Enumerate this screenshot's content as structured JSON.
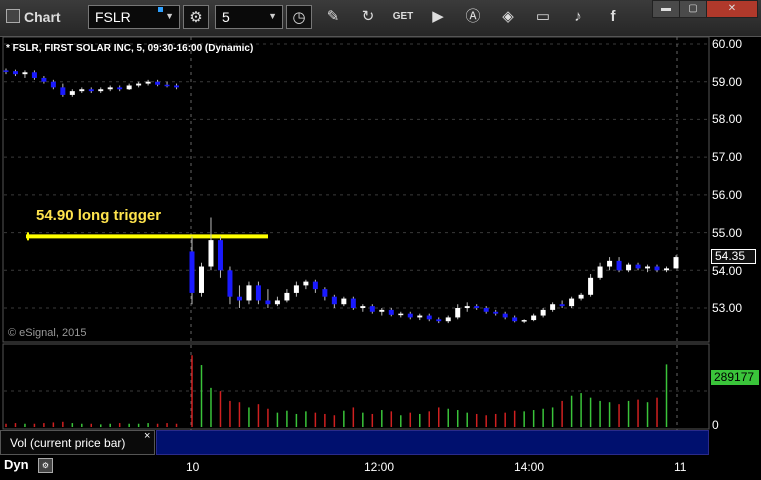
{
  "toolbar": {
    "window_title": "Chart",
    "symbol_value": "FSLR",
    "interval_value": "5",
    "icons": [
      "settings-icon",
      "clock-icon",
      "pencil-icon",
      "refresh-icon",
      "get-icon",
      "play-icon",
      "alert-icon",
      "tag-icon",
      "comment-icon",
      "twitter-icon",
      "facebook-icon"
    ]
  },
  "chart": {
    "legend": "* FSLR, FIRST SOLAR INC, 5, 09:30-16:00 (Dynamic)",
    "copyright": "© eSignal, 2015",
    "annotation": "54.90 long trigger",
    "current_price": "54.35",
    "volume_value": "289177",
    "volume_legend": "Vol (current price bar)",
    "close_mark": "×",
    "bottom_label": "Dyn",
    "y_labels": [
      "60.00",
      "59.00",
      "58.00",
      "57.00",
      "56.00",
      "55.00",
      "54.00",
      "53.00"
    ],
    "vol_y_labels": [
      "0"
    ],
    "x_labels": [
      "10",
      "12:00",
      "14:00",
      "11"
    ],
    "colors": {
      "up": "#ffffff",
      "down": "#1a1aff",
      "trigger": "#ffff00",
      "vol_up": "#3ac43a",
      "vol_down": "#d02020",
      "grid": "#3a3a3a"
    }
  },
  "chart_data": {
    "type": "candlestick",
    "trigger_level": 54.9,
    "ylim": [
      52.5,
      60.2
    ],
    "candles": [
      {
        "o": 59.3,
        "h": 59.35,
        "l": 59.2,
        "c": 59.28
      },
      {
        "o": 59.28,
        "h": 59.32,
        "l": 59.15,
        "c": 59.2
      },
      {
        "o": 59.2,
        "h": 59.3,
        "l": 59.1,
        "c": 59.25
      },
      {
        "o": 59.25,
        "h": 59.3,
        "l": 59.05,
        "c": 59.1
      },
      {
        "o": 59.1,
        "h": 59.15,
        "l": 58.95,
        "c": 59.0
      },
      {
        "o": 59.0,
        "h": 59.05,
        "l": 58.8,
        "c": 58.85
      },
      {
        "o": 58.85,
        "h": 58.95,
        "l": 58.6,
        "c": 58.65
      },
      {
        "o": 58.65,
        "h": 58.8,
        "l": 58.6,
        "c": 58.75
      },
      {
        "o": 58.75,
        "h": 58.85,
        "l": 58.7,
        "c": 58.8
      },
      {
        "o": 58.8,
        "h": 58.85,
        "l": 58.7,
        "c": 58.75
      },
      {
        "o": 58.75,
        "h": 58.85,
        "l": 58.7,
        "c": 58.8
      },
      {
        "o": 58.8,
        "h": 58.9,
        "l": 58.75,
        "c": 58.85
      },
      {
        "o": 58.85,
        "h": 58.9,
        "l": 58.75,
        "c": 58.8
      },
      {
        "o": 58.8,
        "h": 58.95,
        "l": 58.78,
        "c": 58.9
      },
      {
        "o": 58.9,
        "h": 59.0,
        "l": 58.85,
        "c": 58.95
      },
      {
        "o": 58.95,
        "h": 59.05,
        "l": 58.9,
        "c": 59.0
      },
      {
        "o": 59.0,
        "h": 59.05,
        "l": 58.88,
        "c": 58.92
      },
      {
        "o": 58.92,
        "h": 59.0,
        "l": 58.85,
        "c": 58.9
      },
      {
        "o": 58.9,
        "h": 58.95,
        "l": 58.8,
        "c": 58.85
      },
      {
        "o": 54.5,
        "h": 54.9,
        "l": 53.1,
        "c": 53.4
      },
      {
        "o": 53.4,
        "h": 54.2,
        "l": 53.3,
        "c": 54.1
      },
      {
        "o": 54.1,
        "h": 55.4,
        "l": 54.0,
        "c": 54.8
      },
      {
        "o": 54.8,
        "h": 54.9,
        "l": 53.8,
        "c": 54.0
      },
      {
        "o": 54.0,
        "h": 54.1,
        "l": 53.1,
        "c": 53.3
      },
      {
        "o": 53.3,
        "h": 53.6,
        "l": 53.0,
        "c": 53.2
      },
      {
        "o": 53.2,
        "h": 53.7,
        "l": 53.1,
        "c": 53.6
      },
      {
        "o": 53.6,
        "h": 53.7,
        "l": 53.1,
        "c": 53.2
      },
      {
        "o": 53.2,
        "h": 53.5,
        "l": 53.0,
        "c": 53.1
      },
      {
        "o": 53.1,
        "h": 53.3,
        "l": 53.05,
        "c": 53.2
      },
      {
        "o": 53.2,
        "h": 53.5,
        "l": 53.15,
        "c": 53.4
      },
      {
        "o": 53.4,
        "h": 53.7,
        "l": 53.3,
        "c": 53.6
      },
      {
        "o": 53.6,
        "h": 53.75,
        "l": 53.5,
        "c": 53.7
      },
      {
        "o": 53.7,
        "h": 53.75,
        "l": 53.4,
        "c": 53.5
      },
      {
        "o": 53.5,
        "h": 53.55,
        "l": 53.2,
        "c": 53.3
      },
      {
        "o": 53.3,
        "h": 53.35,
        "l": 53.0,
        "c": 53.1
      },
      {
        "o": 53.1,
        "h": 53.3,
        "l": 53.05,
        "c": 53.25
      },
      {
        "o": 53.25,
        "h": 53.3,
        "l": 52.95,
        "c": 53.0
      },
      {
        "o": 53.0,
        "h": 53.1,
        "l": 52.9,
        "c": 53.05
      },
      {
        "o": 53.05,
        "h": 53.1,
        "l": 52.85,
        "c": 52.9
      },
      {
        "o": 52.9,
        "h": 53.0,
        "l": 52.8,
        "c": 52.95
      },
      {
        "o": 52.95,
        "h": 53.0,
        "l": 52.78,
        "c": 52.82
      },
      {
        "o": 52.82,
        "h": 52.9,
        "l": 52.75,
        "c": 52.85
      },
      {
        "o": 52.85,
        "h": 52.9,
        "l": 52.7,
        "c": 52.75
      },
      {
        "o": 52.75,
        "h": 52.85,
        "l": 52.68,
        "c": 52.8
      },
      {
        "o": 52.8,
        "h": 52.85,
        "l": 52.65,
        "c": 52.7
      },
      {
        "o": 52.7,
        "h": 52.75,
        "l": 52.6,
        "c": 52.65
      },
      {
        "o": 52.65,
        "h": 52.8,
        "l": 52.6,
        "c": 52.75
      },
      {
        "o": 52.75,
        "h": 53.1,
        "l": 52.7,
        "c": 53.0
      },
      {
        "o": 53.0,
        "h": 53.15,
        "l": 52.9,
        "c": 53.05
      },
      {
        "o": 53.05,
        "h": 53.1,
        "l": 52.95,
        "c": 53.0
      },
      {
        "o": 53.0,
        "h": 53.05,
        "l": 52.85,
        "c": 52.9
      },
      {
        "o": 52.9,
        "h": 52.95,
        "l": 52.8,
        "c": 52.85
      },
      {
        "o": 52.85,
        "h": 52.9,
        "l": 52.7,
        "c": 52.75
      },
      {
        "o": 52.75,
        "h": 52.8,
        "l": 52.62,
        "c": 52.65
      },
      {
        "o": 52.65,
        "h": 52.7,
        "l": 52.6,
        "c": 52.68
      },
      {
        "o": 52.68,
        "h": 52.85,
        "l": 52.65,
        "c": 52.8
      },
      {
        "o": 52.8,
        "h": 53.0,
        "l": 52.75,
        "c": 52.95
      },
      {
        "o": 52.95,
        "h": 53.15,
        "l": 52.9,
        "c": 53.1
      },
      {
        "o": 53.1,
        "h": 53.2,
        "l": 53.0,
        "c": 53.05
      },
      {
        "o": 53.05,
        "h": 53.3,
        "l": 53.0,
        "c": 53.25
      },
      {
        "o": 53.25,
        "h": 53.4,
        "l": 53.2,
        "c": 53.35
      },
      {
        "o": 53.35,
        "h": 53.9,
        "l": 53.3,
        "c": 53.8
      },
      {
        "o": 53.8,
        "h": 54.2,
        "l": 53.75,
        "c": 54.1
      },
      {
        "o": 54.1,
        "h": 54.35,
        "l": 54.0,
        "c": 54.25
      },
      {
        "o": 54.25,
        "h": 54.35,
        "l": 53.95,
        "c": 54.0
      },
      {
        "o": 54.0,
        "h": 54.2,
        "l": 53.95,
        "c": 54.15
      },
      {
        "o": 54.15,
        "h": 54.2,
        "l": 54.0,
        "c": 54.05
      },
      {
        "o": 54.05,
        "h": 54.15,
        "l": 53.95,
        "c": 54.1
      },
      {
        "o": 54.1,
        "h": 54.15,
        "l": 53.95,
        "c": 54.0
      },
      {
        "o": 54.0,
        "h": 54.1,
        "l": 53.95,
        "c": 54.05
      },
      {
        "o": 54.05,
        "h": 54.4,
        "l": 54.05,
        "c": 54.35
      }
    ],
    "volume": [
      5,
      6,
      5,
      5,
      6,
      7,
      8,
      6,
      5,
      5,
      4,
      5,
      6,
      5,
      5,
      6,
      5,
      6,
      5,
      110,
      95,
      60,
      55,
      40,
      38,
      30,
      35,
      28,
      22,
      25,
      20,
      24,
      22,
      20,
      18,
      25,
      30,
      22,
      20,
      26,
      24,
      18,
      22,
      20,
      24,
      30,
      28,
      26,
      22,
      20,
      18,
      20,
      22,
      25,
      24,
      26,
      28,
      30,
      40,
      48,
      52,
      45,
      40,
      38,
      35,
      40,
      42,
      38,
      45,
      96
    ]
  }
}
